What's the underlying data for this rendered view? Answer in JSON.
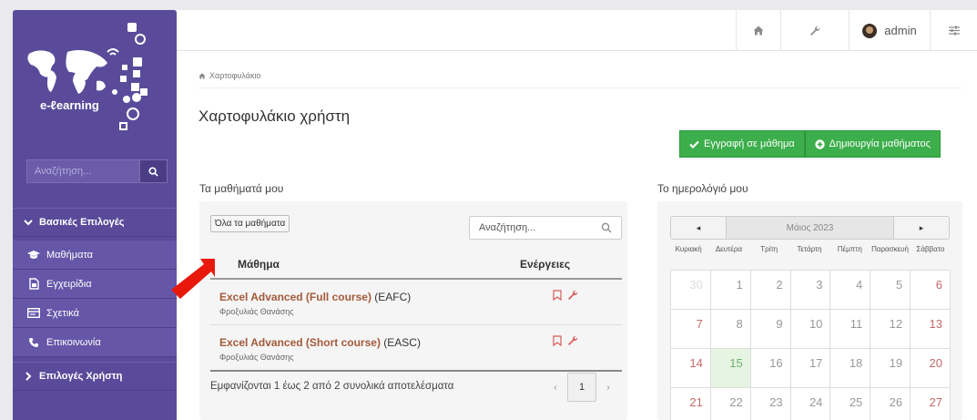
{
  "sidebar": {
    "logo_text": "e-ℓearning",
    "search_placeholder": "Αναζήτηση...",
    "sections": [
      {
        "label": "Βασικές Επιλογές"
      },
      {
        "label": "Επιλογές Χρήστη"
      }
    ],
    "items": [
      {
        "label": "Μαθήματα",
        "icon": "graduation-cap-icon"
      },
      {
        "label": "Εγχειρίδια",
        "icon": "document-icon"
      },
      {
        "label": "Σχετικά",
        "icon": "card-icon"
      },
      {
        "label": "Επικοινωνία",
        "icon": "phone-icon"
      }
    ]
  },
  "topbar": {
    "username": "admin",
    "icons": [
      "home-icon",
      "wrench-icon",
      "avatar",
      "sliders-icon"
    ]
  },
  "breadcrumb": "Χαρτοφυλάκιο",
  "page_title": "Χαρτοφυλάκιο χρήστη",
  "buttons": {
    "enroll": "Εγγραφή σε μάθημα",
    "create": "Δημιουργία μαθήματος"
  },
  "courses_panel": {
    "title": "Τα μαθήματά μου",
    "filter_label": "Όλα τα μαθήματα",
    "search_placeholder": "Αναζήτηση...",
    "col_course": "Μάθημα",
    "col_actions": "Ενέργειες",
    "rows": [
      {
        "name": "Excel Advanced (Full course)",
        "code": " (EAFC)",
        "teacher": "Φροξυλιάς Θανάσης"
      },
      {
        "name": "Excel Advanced (Short course)",
        "code": " (EASC)",
        "teacher": "Φροξυλιάς Θανάσης"
      }
    ],
    "pagination_info": "Εμφανίζονται 1 έως 2 από 2 συνολικά αποτελέσματα",
    "current_page": "1",
    "prev": "‹",
    "next": "›"
  },
  "calendar": {
    "title": "Το ημερολόγιό μου",
    "month": "Μάιος 2023",
    "prev": "◂",
    "next": "▸",
    "days_of_week": [
      "Κυριακή",
      "Δευτέρα",
      "Τρίτη",
      "Τετάρτη",
      "Πέμπτη",
      "Παρασκευή",
      "Σάββατο"
    ],
    "weeks": [
      [
        "30",
        "1",
        "2",
        "3",
        "4",
        "5",
        "6"
      ],
      [
        "7",
        "8",
        "9",
        "10",
        "11",
        "12",
        "13"
      ],
      [
        "14",
        "15",
        "16",
        "17",
        "18",
        "19",
        "20"
      ],
      [
        "21",
        "22",
        "23",
        "24",
        "25",
        "26",
        "27"
      ]
    ],
    "today": "15"
  },
  "colors": {
    "sidebar": "#5a4b9a",
    "green": "#3cae4b",
    "link": "#a35a3a",
    "arrow": "#e8190c"
  }
}
